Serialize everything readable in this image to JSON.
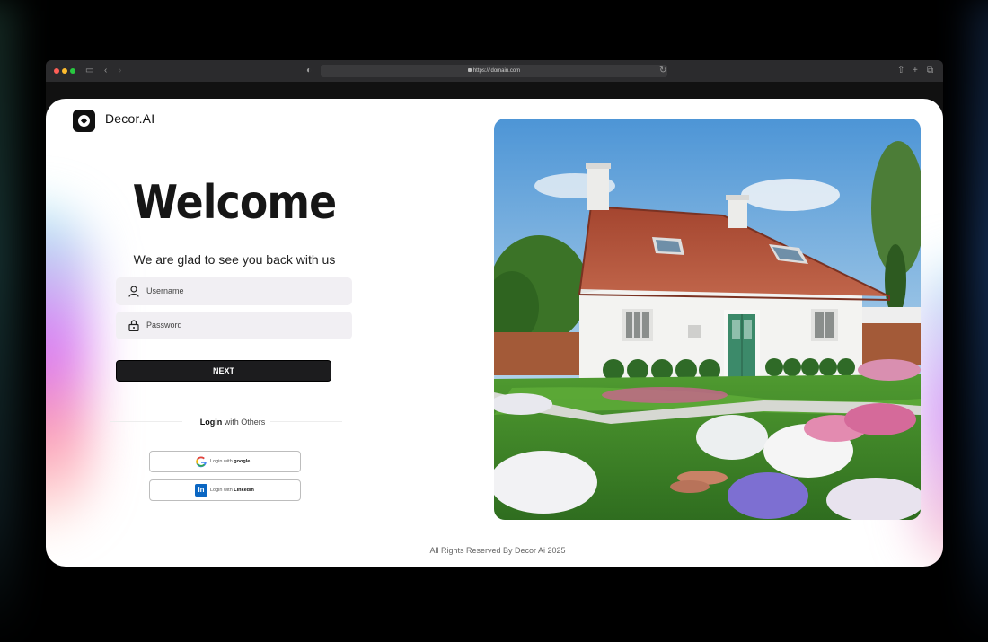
{
  "browser": {
    "url": "https:// domain.com"
  },
  "brand": {
    "name": "Decor.AI"
  },
  "login": {
    "heading": "Welcome",
    "subtitle": "We are glad to see you back with us",
    "username_placeholder": "Username",
    "password_placeholder": "Password",
    "next_label": "NEXT",
    "others_bold": "Login",
    "others_rest": " with Others",
    "google_prefix": "Login with ",
    "google_name": "google",
    "linkedin_prefix": "Login with ",
    "linkedin_name": "Linkedin"
  },
  "footer": {
    "text": "All Rights Reserved By Decor Ai 2025"
  },
  "colors": {
    "button": "#1c1c1e",
    "field_bg": "#f1eff3",
    "roof": "#b5563d",
    "door": "#3c8a6a",
    "lawn": "#3f7f2a"
  }
}
